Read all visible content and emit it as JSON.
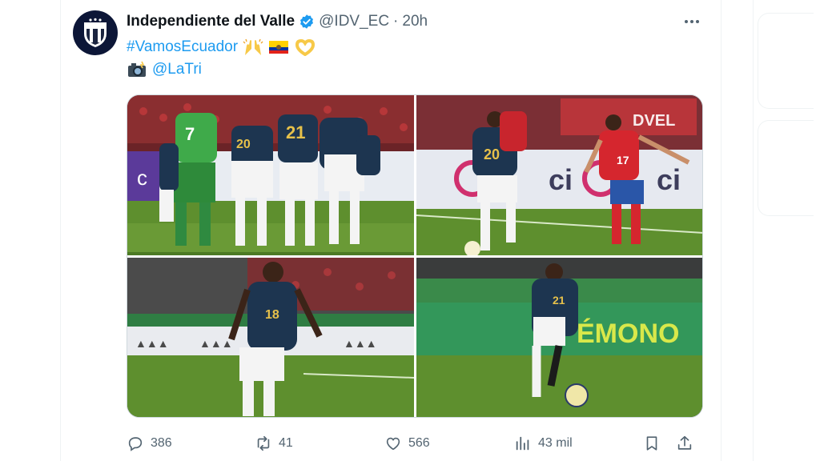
{
  "author": {
    "display_name": "Independiente del Valle",
    "handle": "@IDV_EC",
    "separator": "·",
    "time": "20h"
  },
  "body": {
    "hashtag": "#VamosEcuador",
    "emojis_line1": [
      "raising-hands-emoji",
      "ecuador-flag-emoji",
      "heart-hands-emoji"
    ],
    "camera_emoji": "camera-with-flash-emoji",
    "mention": "@LaTri"
  },
  "media": {
    "photos": [
      {
        "alt": "team-huddle"
      },
      {
        "alt": "player-20-vs-chile-17"
      },
      {
        "alt": "player-18-dribbling"
      },
      {
        "alt": "player-21-with-ball"
      }
    ],
    "jersey_numbers": [
      "20",
      "21",
      "20",
      "17",
      "18",
      "21"
    ],
    "banner_text": "ÉMONO"
  },
  "actions": {
    "replies": "386",
    "reposts": "41",
    "likes": "566",
    "views": "43 mil"
  },
  "colors": {
    "accent": "#1d9bf0",
    "secondary_text": "#536471",
    "ecuador_kit": "#1d3550",
    "chile_kit": "#d5262e",
    "pitch": "#5e8f2e"
  }
}
